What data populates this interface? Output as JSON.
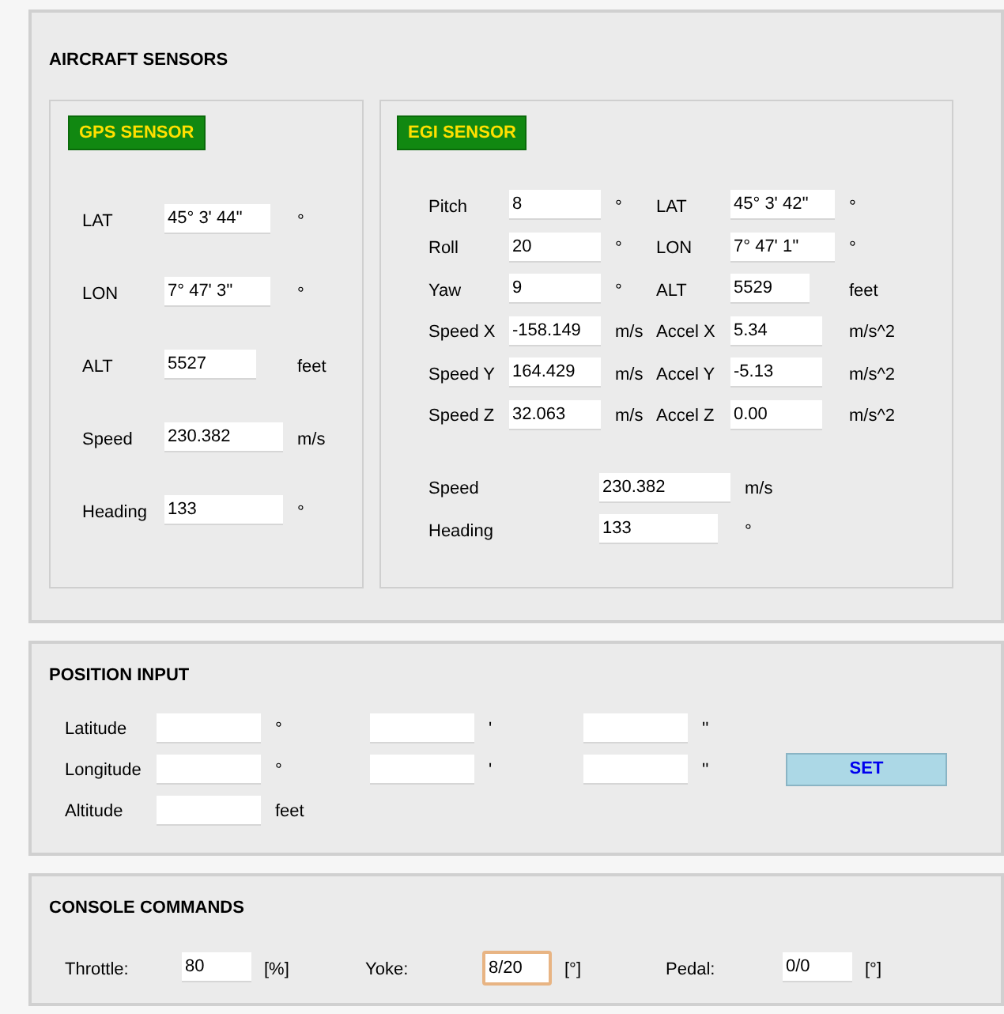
{
  "aircraft_sensors": {
    "title": "AIRCRAFT SENSORS",
    "gps": {
      "title": "GPS SENSOR",
      "rows": [
        {
          "label": "LAT",
          "value": "45° 3' 44''",
          "unit": "°"
        },
        {
          "label": "LON",
          "value": "7° 47' 3''",
          "unit": "°"
        },
        {
          "label": "ALT",
          "value": "5527",
          "unit": "feet"
        },
        {
          "label": "Speed",
          "value": "230.382",
          "unit": "m/s"
        },
        {
          "label": "Heading",
          "value": "133",
          "unit": "°"
        }
      ]
    },
    "egi": {
      "title": "EGI SENSOR",
      "rows": [
        {
          "left": {
            "label": "Pitch",
            "value": "8",
            "unit": "°"
          },
          "right": {
            "label": "LAT",
            "value": "45° 3' 42''",
            "unit": "°"
          }
        },
        {
          "left": {
            "label": "Roll",
            "value": "20",
            "unit": "°"
          },
          "right": {
            "label": "LON",
            "value": "7° 47' 1''",
            "unit": "°"
          }
        },
        {
          "left": {
            "label": "Yaw",
            "value": "9",
            "unit": "°"
          },
          "right": {
            "label": "ALT",
            "value": "5529",
            "unit": "feet"
          }
        },
        {
          "left": {
            "label": "Speed X",
            "value": "-158.149",
            "unit": "m/s"
          },
          "right": {
            "label": "Accel X",
            "value": "5.34",
            "unit": "m/s^2"
          }
        },
        {
          "left": {
            "label": "Speed Y",
            "value": "164.429",
            "unit": "m/s"
          },
          "right": {
            "label": "Accel Y",
            "value": "-5.13",
            "unit": "m/s^2"
          }
        },
        {
          "left": {
            "label": "Speed Z",
            "value": "32.063",
            "unit": "m/s"
          },
          "right": {
            "label": "Accel Z",
            "value": "0.00",
            "unit": "m/s^2"
          }
        }
      ],
      "summary": [
        {
          "label": "Speed",
          "value": "230.382",
          "unit": "m/s"
        },
        {
          "label": "Heading",
          "value": "133",
          "unit": "°"
        }
      ]
    }
  },
  "position_input": {
    "title": "POSITION INPUT",
    "rows": [
      {
        "label": "Latitude",
        "fields": [
          {
            "unit": "°"
          },
          {
            "unit": "'"
          },
          {
            "unit": "''"
          }
        ]
      },
      {
        "label": "Longitude",
        "fields": [
          {
            "unit": "°"
          },
          {
            "unit": "'"
          },
          {
            "unit": "''"
          }
        ]
      },
      {
        "label": "Altitude",
        "fields": [
          {
            "unit": "feet"
          }
        ]
      }
    ],
    "button": "SET"
  },
  "console_commands": {
    "title": "CONSOLE COMMANDS",
    "items": [
      {
        "label": "Throttle:",
        "value": "80",
        "unit": "[%]",
        "focused": false
      },
      {
        "label": "Yoke:",
        "value": "8/20",
        "unit": "[°]",
        "focused": true
      },
      {
        "label": "Pedal:",
        "value": "0/0",
        "unit": "[°]",
        "focused": false
      }
    ]
  }
}
